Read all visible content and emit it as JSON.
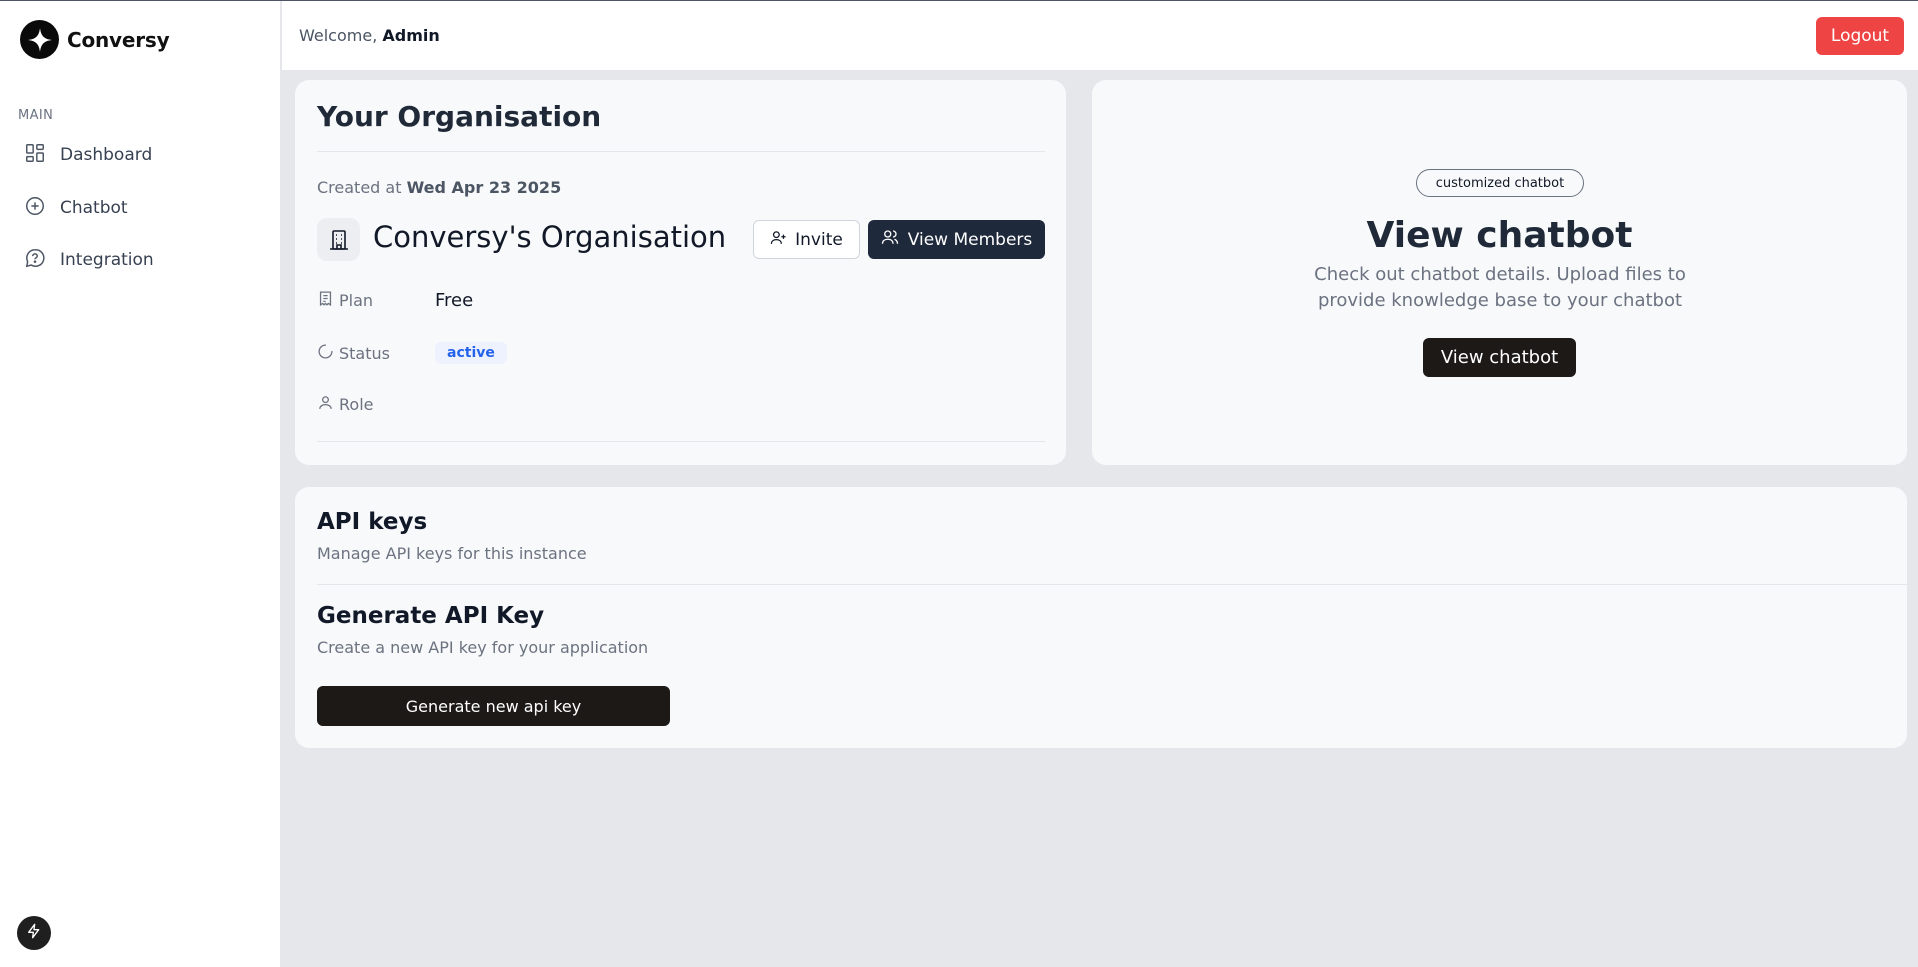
{
  "app": {
    "name": "Conversy"
  },
  "sidebar": {
    "section_label": "MAIN",
    "items": [
      {
        "label": "Dashboard",
        "icon": "dashboard-icon"
      },
      {
        "label": "Chatbot",
        "icon": "plus-circle-icon"
      },
      {
        "label": "Integration",
        "icon": "chat-bubble-icon"
      }
    ]
  },
  "header": {
    "welcome_prefix": "Welcome,",
    "username": "Admin",
    "logout_label": "Logout",
    "logout_color": "#ef4444"
  },
  "organisation": {
    "title": "Your Organisation",
    "created_prefix": "Created at",
    "created_date": "Wed Apr 23 2025",
    "name": "Conversy's Organisation",
    "invite_label": "Invite",
    "view_members_label": "View Members",
    "plan_label": "Plan",
    "plan_value": "Free",
    "status_label": "Status",
    "status_value": "active",
    "role_label": "Role",
    "role_value": ""
  },
  "chatbot": {
    "badge": "customized chatbot",
    "heading": "View chatbot",
    "description": "Check out chatbot details. Upload files to provide knowledge base to your chatbot",
    "button_label": "View chatbot"
  },
  "api_keys": {
    "title": "API keys",
    "subtitle": "Manage API keys for this instance",
    "generate_title": "Generate API Key",
    "generate_subtitle": "Create a new API key for your application",
    "generate_button": "Generate new api key"
  }
}
